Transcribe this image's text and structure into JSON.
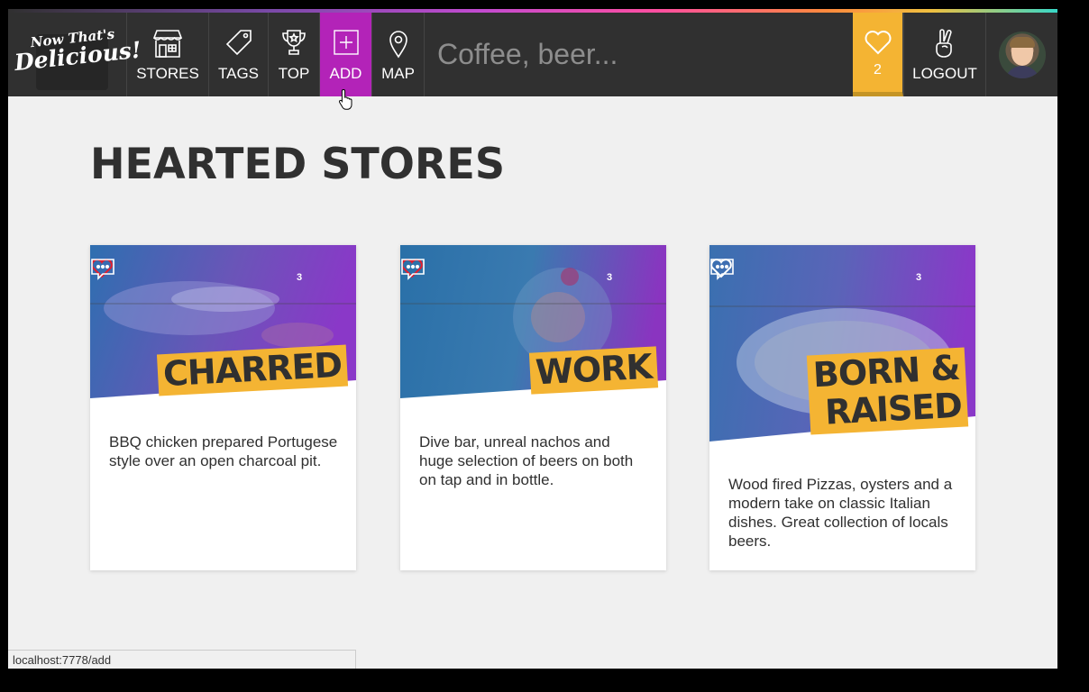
{
  "app": {
    "logo_line1": "Now That's",
    "logo_line2": "Delicious!"
  },
  "nav": {
    "items": [
      {
        "label": "STORES",
        "icon": "store-icon"
      },
      {
        "label": "TAGS",
        "icon": "tag-icon"
      },
      {
        "label": "TOP",
        "icon": "trophy-icon"
      },
      {
        "label": "ADD",
        "icon": "add-icon",
        "active": true
      },
      {
        "label": "MAP",
        "icon": "map-pin-icon"
      }
    ],
    "search_placeholder": "Coffee, beer...",
    "hearts_count": "2",
    "logout_label": "LOGOUT"
  },
  "page": {
    "title": "HEARTED STORES"
  },
  "stores": [
    {
      "name": "CHARRED",
      "description": "BBQ chicken prepared Portugese style over an open charcoal pit.",
      "comments": "3",
      "hearted": true
    },
    {
      "name": "WORK",
      "description": "Dive bar, unreal nachos and huge selection of beers on both on tap and in bottle.",
      "comments": "3",
      "hearted": true
    },
    {
      "name_line1": "BORN &",
      "name_line2": "RAISED",
      "description": "Wood fired Pizzas, oysters and a modern take on classic Italian dishes. Great collection of locals beers.",
      "comments": "3",
      "hearted": false
    }
  ],
  "statusbar": {
    "url": "localhost:7778/add"
  },
  "colors": {
    "nav_bg": "#303030",
    "add_active": "#b323b8",
    "heart_accent": "#f4b433",
    "tag_bg": "#f4b433",
    "text": "#303030"
  }
}
